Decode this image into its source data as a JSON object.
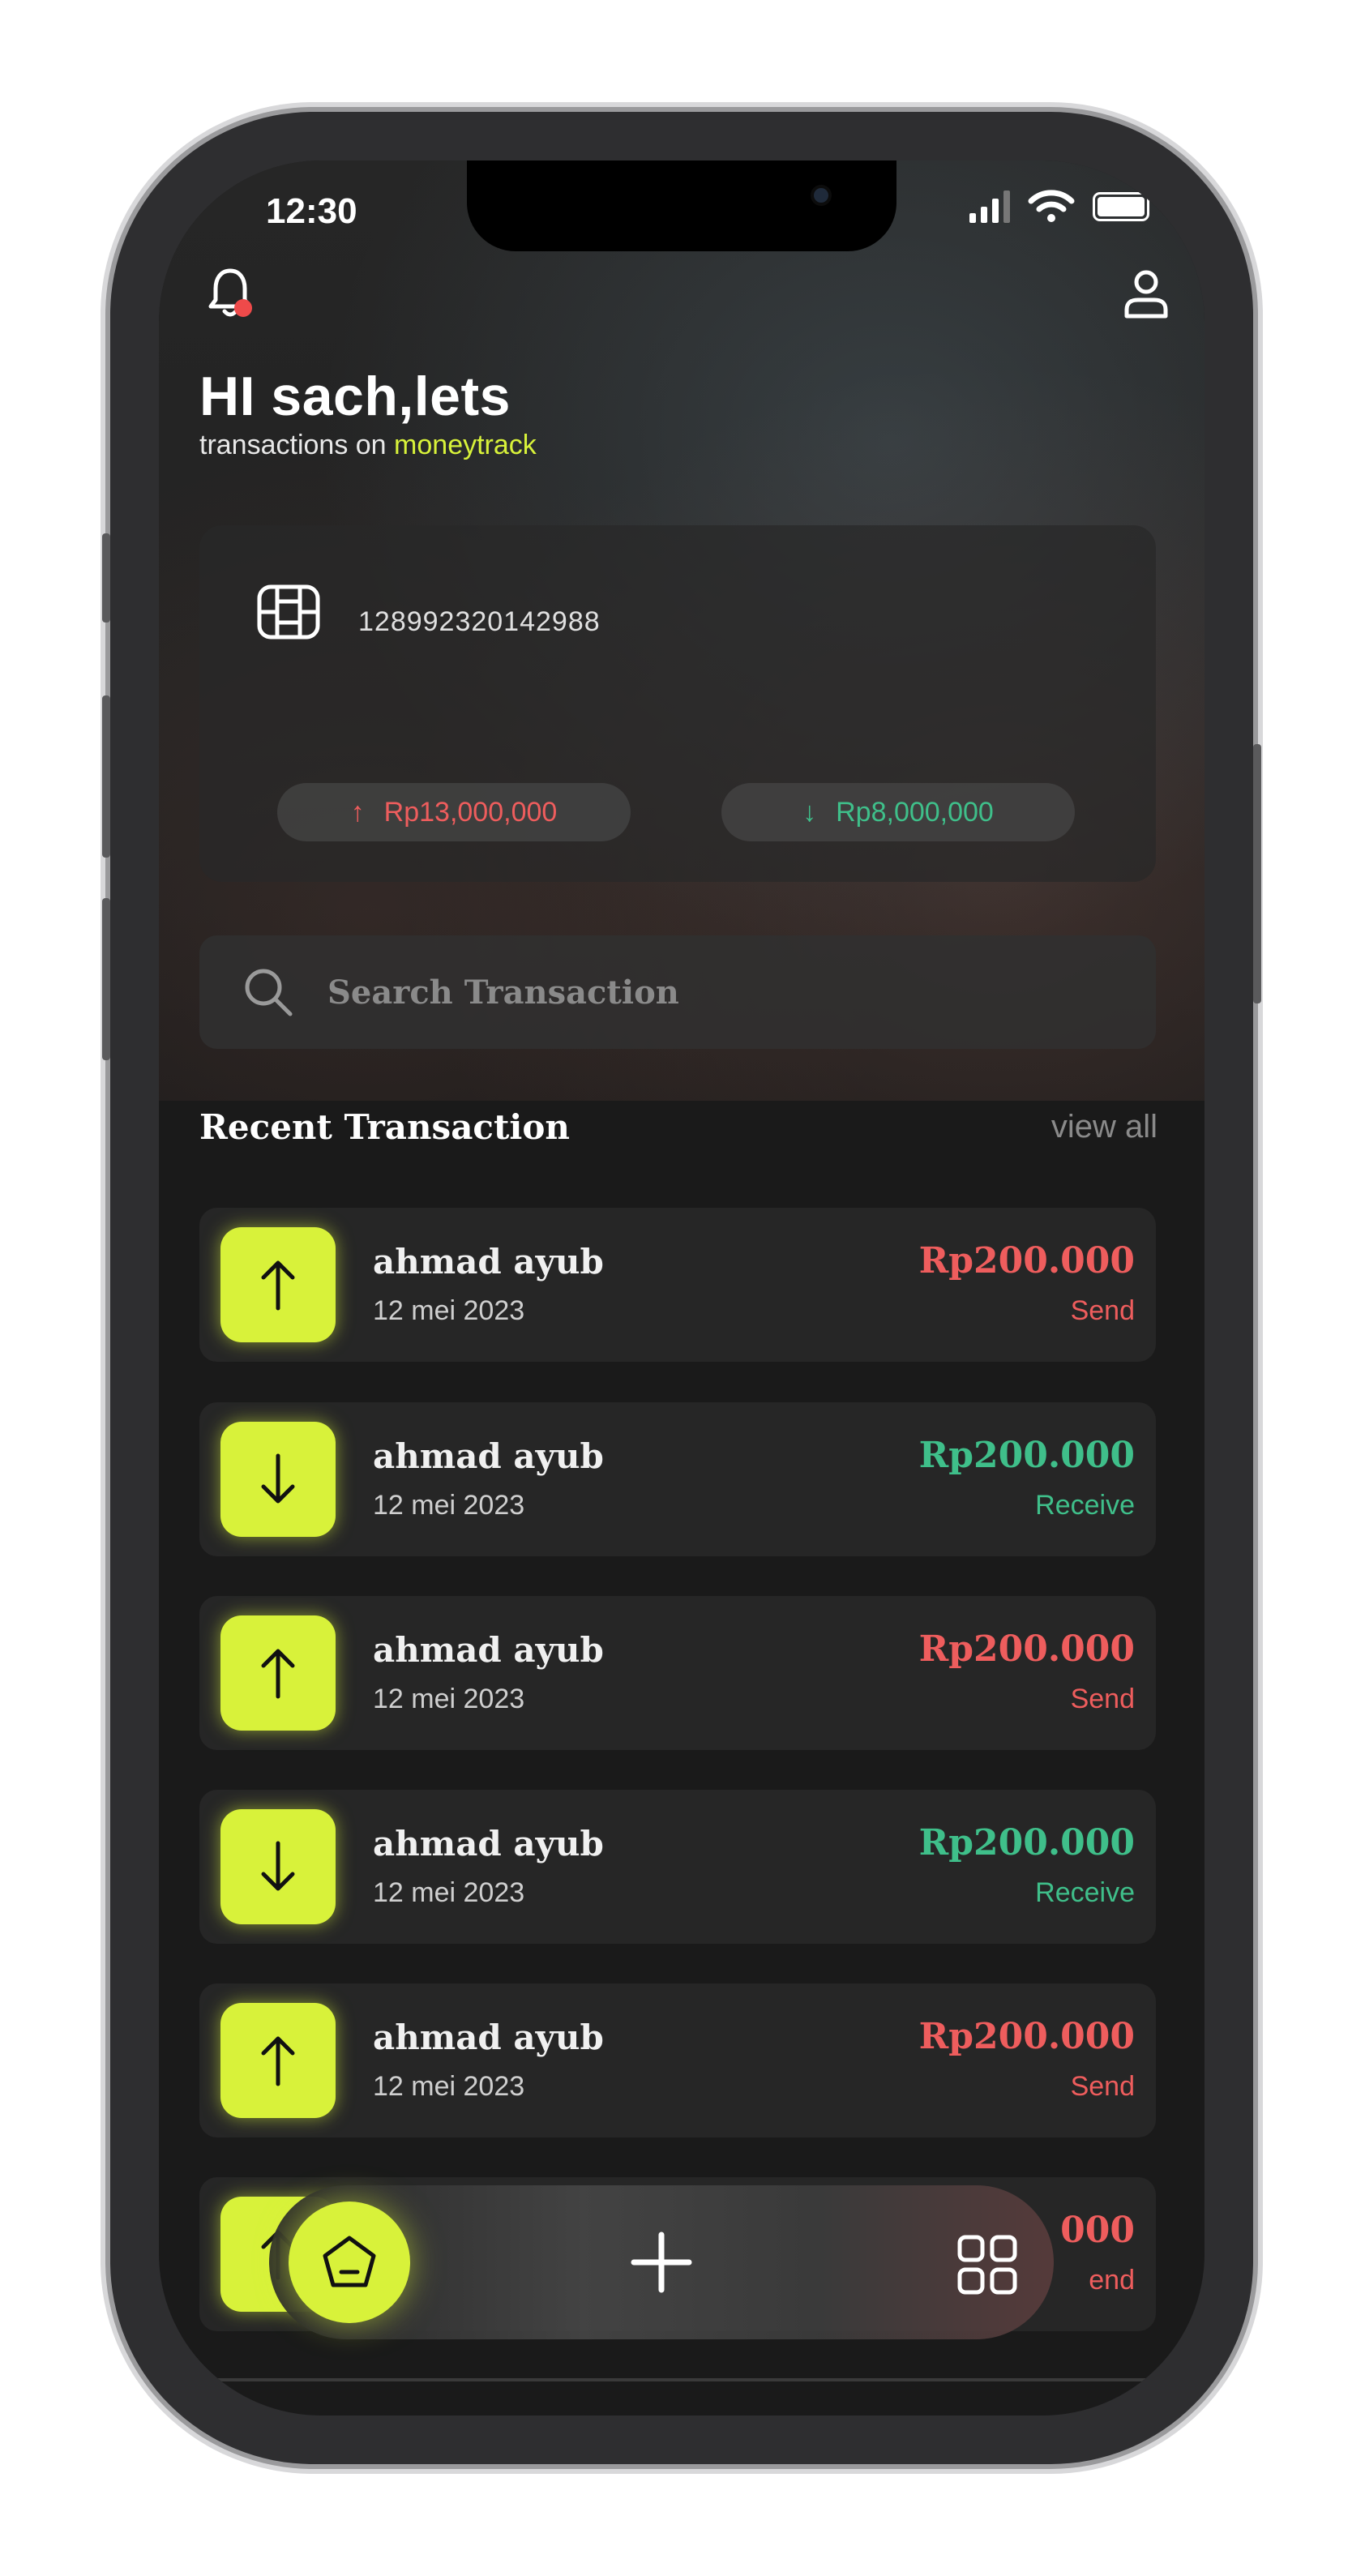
{
  "status_bar": {
    "time": "12:30"
  },
  "header": {
    "greeting": "HI sach,lets",
    "subtitle_prefix": "transactions on",
    "brand": "moneytrack"
  },
  "card": {
    "number": "128992320142988",
    "income_arrow": "↑",
    "income": "Rp13,000,000",
    "expense_arrow": "↓",
    "expense": "Rp8,000,000"
  },
  "search": {
    "placeholder": "Search Transaction"
  },
  "recent": {
    "title": "Recent Transaction",
    "view_all": "view all",
    "items": [
      {
        "name": "ahmad ayub",
        "date": "12 mei 2023",
        "amount": "Rp200.000",
        "type": "Send",
        "direction": "up"
      },
      {
        "name": "ahmad ayub",
        "date": "12 mei 2023",
        "amount": "Rp200.000",
        "type": "Receive",
        "direction": "down"
      },
      {
        "name": "ahmad ayub",
        "date": "12 mei 2023",
        "amount": "Rp200.000",
        "type": "Send",
        "direction": "up"
      },
      {
        "name": "ahmad ayub",
        "date": "12 mei 2023",
        "amount": "Rp200.000",
        "type": "Receive",
        "direction": "down"
      },
      {
        "name": "ahmad ayub",
        "date": "12 mei 2023",
        "amount": "Rp200.000",
        "type": "Send",
        "direction": "up"
      },
      {
        "name": "",
        "date": "",
        "amount": "000",
        "type": "end",
        "direction": "up"
      }
    ]
  },
  "colors": {
    "accent": "#d8f23a",
    "send": "#ee5d5d",
    "receive": "#3fbf8a",
    "background": "#1a1a1a"
  },
  "icons": [
    "bell-icon",
    "profile-icon",
    "chip-icon",
    "search-icon",
    "arrow-up-icon",
    "arrow-down-icon",
    "home-icon",
    "plus-icon",
    "grid-icon"
  ]
}
